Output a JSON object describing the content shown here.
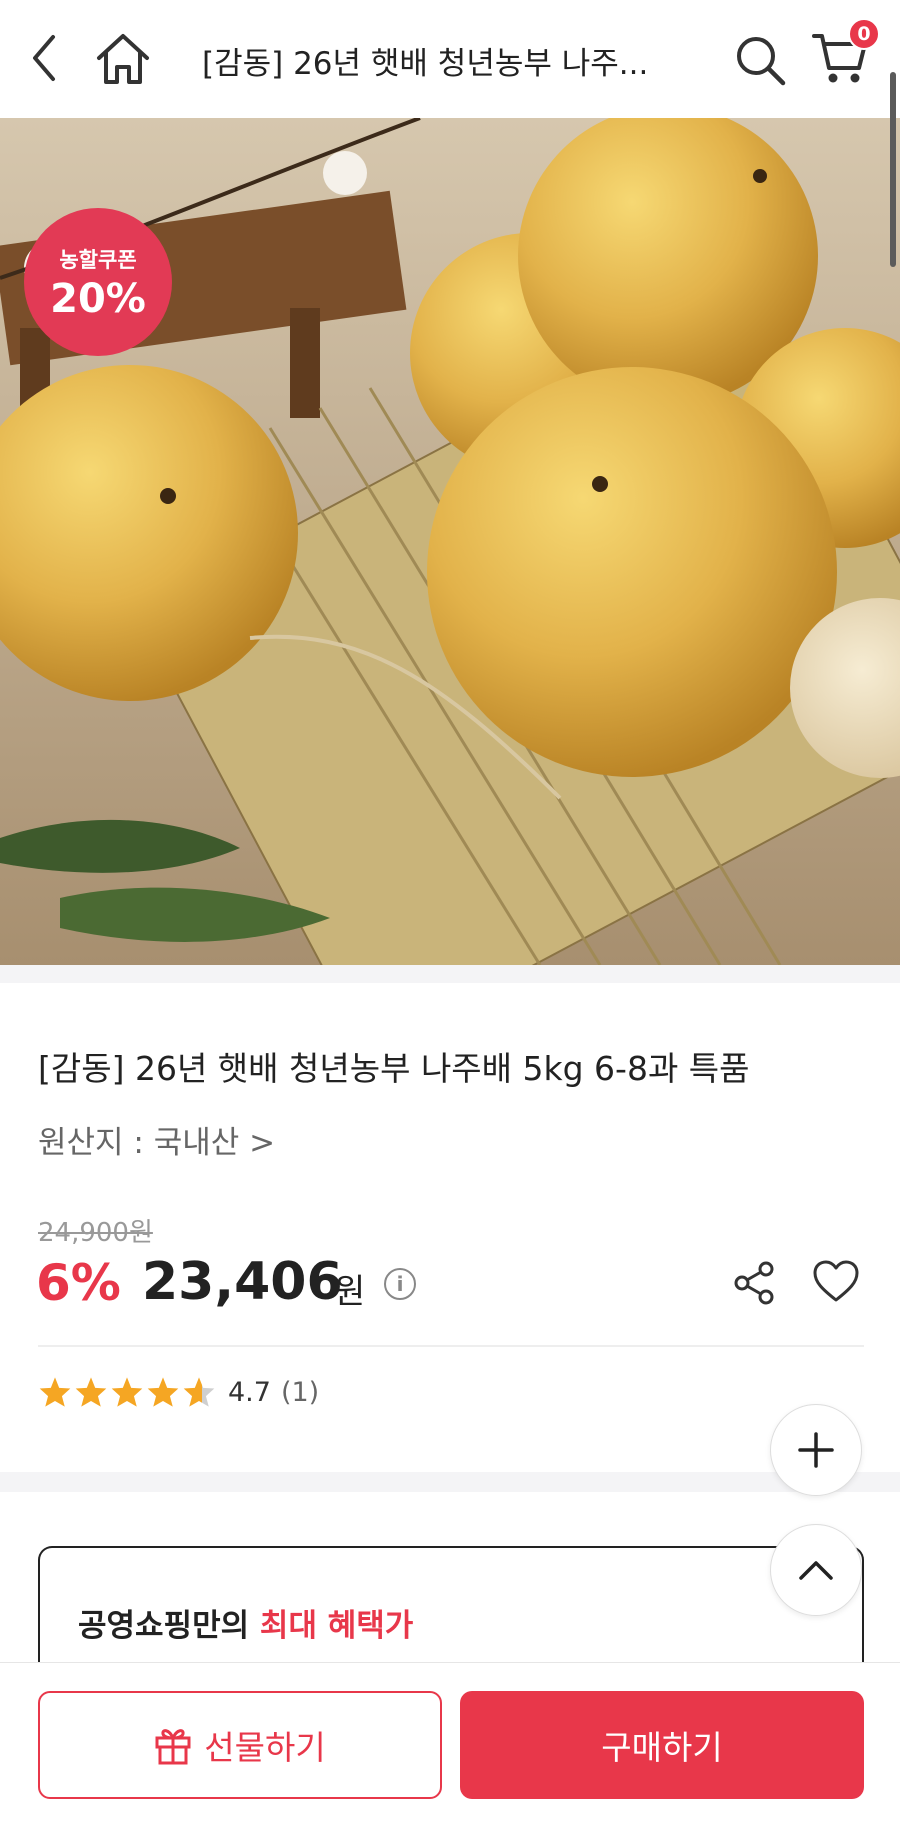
{
  "header": {
    "title": "[감동] 26년 햇배 청년농부 나주...",
    "cart_count": "0",
    "icons": [
      "back-icon",
      "home-icon",
      "search-icon",
      "cart-icon"
    ]
  },
  "hero": {
    "coupon_label": "농할쿠폰",
    "coupon_value": "20%"
  },
  "product": {
    "title": "[감동] 26년 햇배 청년농부 나주배 5kg 6-8과 특품",
    "origin": "원산지 : 국내산 >",
    "original_price": "24,900원",
    "discount": "6%",
    "price": "23,406",
    "currency": "원",
    "info_glyph": "i",
    "rating": "4.7",
    "rating_value": 4.7,
    "review_count": "(1)"
  },
  "benefit": {
    "text_plain": "공영쇼핑만의 ",
    "text_highlight": "최대 혜택가"
  },
  "bottom_bar": {
    "gift_label": "선물하기",
    "buy_label": "구매하기"
  },
  "colors": {
    "accent": "#e8374a",
    "coupon": "#e23a55",
    "star": "#f5a623"
  }
}
